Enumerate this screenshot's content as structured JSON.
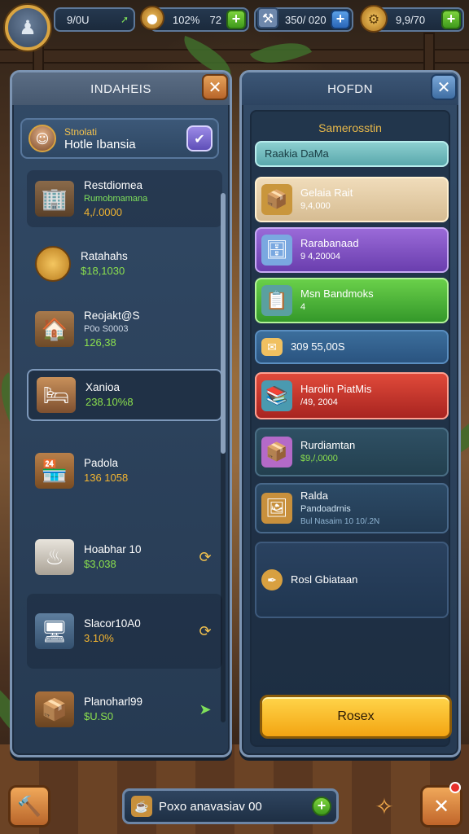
{
  "topbar": {
    "avatar_icon": "user-silhouette-icon",
    "resources": [
      {
        "value": "9/0U",
        "icon": "none"
      },
      {
        "value": "102%",
        "suffix": "72",
        "icon": "coin-bag-icon"
      },
      {
        "value": "350/ 020",
        "icon": "tool-icon"
      },
      {
        "value": "9,9/70",
        "icon": "gear-badge-icon"
      }
    ]
  },
  "left_panel": {
    "title": "INDAHEIS",
    "profile": {
      "subtitle": "Stnolati",
      "name": "Hotle Ibansia"
    },
    "items": [
      {
        "title": "Restdiomea",
        "subtitle": "Rumobmamana",
        "value": "4,/.0000",
        "icon": "building-icon",
        "value_color": "gold"
      },
      {
        "title": "Ratahahs",
        "value": "$18,1030",
        "icon": "gold-coin-icon",
        "value_color": "green"
      },
      {
        "title": "Reojakt@S",
        "subtitle": "P0o S0003",
        "value": "126,38",
        "icon": "house-icon",
        "value_color": "green"
      },
      {
        "title": "Xanioa",
        "value": "238.10%8",
        "icon": "reception-desk-icon",
        "value_color": "green"
      },
      {
        "title": "Padola",
        "value": "136 1058",
        "icon": "shop-icon",
        "value_color": "gold"
      },
      {
        "title": "Hoabhar 10",
        "value": "$3,038",
        "icon": "spa-icon",
        "value_color": "green"
      },
      {
        "title": "Slacor10A0",
        "value": "3.10%",
        "icon": "computer-desk-icon",
        "value_color": "gold"
      },
      {
        "title": "Planoharl99",
        "value": "$U.S0",
        "icon": "crate-icon",
        "value_color": "green"
      }
    ]
  },
  "right_panel": {
    "title": "HOFDN",
    "subtitle": "Samerosstin",
    "rows": [
      {
        "title": "Raakia DaMa"
      },
      {
        "title": "Gelaia Rait",
        "value": "9,4,000"
      },
      {
        "title": "Rarabanaad",
        "value": "9 4,20004"
      },
      {
        "title": "Msn Bandmoks",
        "value": "4"
      },
      {
        "title": "309 55,00S"
      },
      {
        "title": "Harolin PiatMis",
        "value": "/49, 2004"
      },
      {
        "title": "Rurdiamtan",
        "value": "$9,/,0000"
      },
      {
        "title": "Ralda",
        "value": "Pandoadrnis",
        "extra": "Bul Nasaim 10 10/.2N"
      },
      {
        "title": "Rosl Gbiataan"
      }
    ],
    "action_label": "Rosex"
  },
  "bottombar": {
    "center_text": "Poxo anavasiav 00"
  },
  "colors": {
    "accent_gold": "#f2b431",
    "accent_green": "#8be04e",
    "panel_blue": "#324a66",
    "action_yellow": "#ffd54a"
  }
}
